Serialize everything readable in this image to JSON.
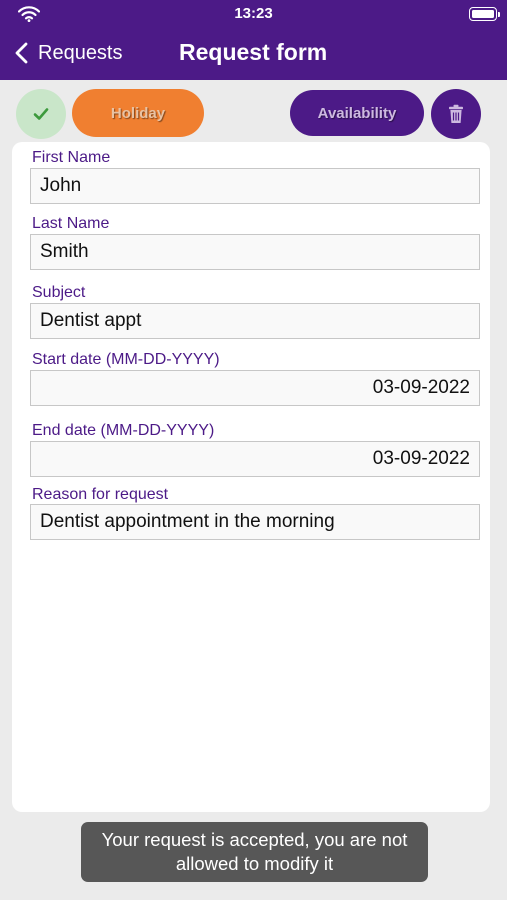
{
  "status_bar": {
    "time": "13:23",
    "wifi_icon": "wifi-icon",
    "battery_icon": "battery-icon"
  },
  "nav": {
    "back_label": "Requests",
    "title": "Request form",
    "back_icon": "chevron-left-icon"
  },
  "actions": {
    "accepted_icon": "checkmark-icon",
    "holiday_label": "Holiday",
    "availability_label": "Availability",
    "delete_icon": "trash-icon"
  },
  "form": {
    "first_name": {
      "label": "First Name",
      "value": "John"
    },
    "last_name": {
      "label": "Last Name",
      "value": "Smith"
    },
    "subject": {
      "label": "Subject",
      "value": "Dentist appt"
    },
    "start_date": {
      "label": "Start date (MM-DD-YYYY)",
      "value": "03-09-2022"
    },
    "end_date": {
      "label": "End date (MM-DD-YYYY)",
      "value": "03-09-2022"
    },
    "reason": {
      "label": "Reason for request",
      "value": "Dentist appointment in the morning"
    }
  },
  "toast": {
    "line1": "Your request is accepted, you are not",
    "line2": "allowed to modify it"
  },
  "colors": {
    "header": "#4c1a87",
    "accent_orange": "#f07f30",
    "accepted_green": "#c9e6c9",
    "label_purple": "#4c1a87"
  }
}
